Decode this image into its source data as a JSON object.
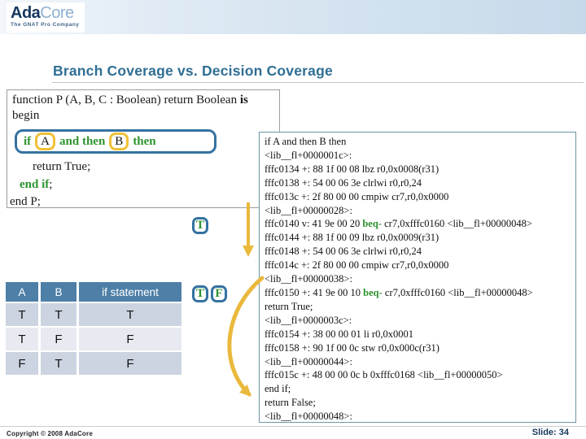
{
  "header": {
    "brand_ada": "Ada",
    "brand_core": "Core",
    "tagline": "The GNAT Pro Company"
  },
  "title": "Branch Coverage vs. Decision Coverage",
  "source_code": {
    "declaration": "function P (A, B, C : Boolean) return Boolean ",
    "declaration_keyword": "is",
    "begin": "begin",
    "if_tokens": [
      {
        "text": "if",
        "type": "keyword"
      },
      {
        "text": "A",
        "type": "operand"
      },
      {
        "text": "and then",
        "type": "keyword"
      },
      {
        "text": "B",
        "type": "operand"
      },
      {
        "text": "then",
        "type": "keyword"
      }
    ],
    "return_true": "return True;",
    "end_if": "end if",
    "end_if_punct": ";",
    "end_p": "end P;"
  },
  "branch_badges": {
    "if_true": "T",
    "pair_true": "T",
    "pair_false": "F"
  },
  "truth_table": {
    "headers": [
      "A",
      "B",
      "if statement"
    ],
    "rows": [
      [
        "T",
        "T",
        "T"
      ],
      [
        "T",
        "F",
        "F"
      ],
      [
        "F",
        "T",
        "F"
      ]
    ]
  },
  "assembly": {
    "lines": [
      [
        {
          "t": "if A and then B then"
        }
      ],
      [
        {
          "t": "<lib__fl+0000001c>:"
        }
      ],
      [
        {
          "t": "fffc0134 +: 88 1f 00 08 lbz r0,0x0008(r31)"
        }
      ],
      [
        {
          "t": "fffc0138 +: 54 00 06 3e clrlwi r0,r0,24"
        }
      ],
      [
        {
          "t": "fffc013c +: 2f 80 00 00 cmpiw cr7,r0,0x0000"
        }
      ],
      [
        {
          "t": "<lib__fl+00000028>:"
        }
      ],
      [
        {
          "t": "fffc0140 v: 41 9e 00 20 "
        },
        {
          "t": "beq-",
          "k": "kw"
        },
        {
          "t": " cr7,0xfffc0160 <lib__fl+00000048>"
        }
      ],
      [
        {
          "t": "fffc0144 +: 88 1f 00 09 lbz r0,0x0009(r31)"
        }
      ],
      [
        {
          "t": "fffc0148 +: 54 00 06 3e clrlwi r0,r0,24"
        }
      ],
      [
        {
          "t": "fffc014c +: 2f 80 00 00 cmpiw cr7,r0,0x0000"
        }
      ],
      [
        {
          "t": "<lib__fl+00000038>:"
        }
      ],
      [
        {
          "t": "fffc0150 +: 41 9e 00 10 "
        },
        {
          "t": "beq-",
          "k": "kw"
        },
        {
          "t": " cr7,0xfffc0160 <lib__fl+00000048>"
        }
      ],
      [
        {
          "t": "return True;"
        }
      ],
      [
        {
          "t": "<lib__fl+0000003c>:"
        }
      ],
      [
        {
          "t": "fffc0154 +: 38 00 00 01 li r0,0x0001"
        }
      ],
      [
        {
          "t": "fffc0158 +: 90 1f 00 0c stw r0,0x000c(r31)"
        }
      ],
      [
        {
          "t": "<lib__fl+00000044>:"
        }
      ],
      [
        {
          "t": "fffc015c +: 48 00 00 0c b 0xfffc0168 <lib__fl+00000050>"
        }
      ],
      [
        {
          "t": "end if;"
        }
      ],
      [
        {
          "t": "return False;"
        }
      ],
      [
        {
          "t": "<lib__fl+00000048>:"
        }
      ]
    ]
  },
  "footer": {
    "copyright": "Copyright © 2008 AdaCore",
    "slide": "Slide: 34"
  },
  "colors": {
    "accent_blue": "#3572a2",
    "keyword_green": "#2e9330",
    "highlight_gold": "#eab93c",
    "table_header_blue": "#4d7fa7",
    "title_blue": "#2f6e94"
  }
}
